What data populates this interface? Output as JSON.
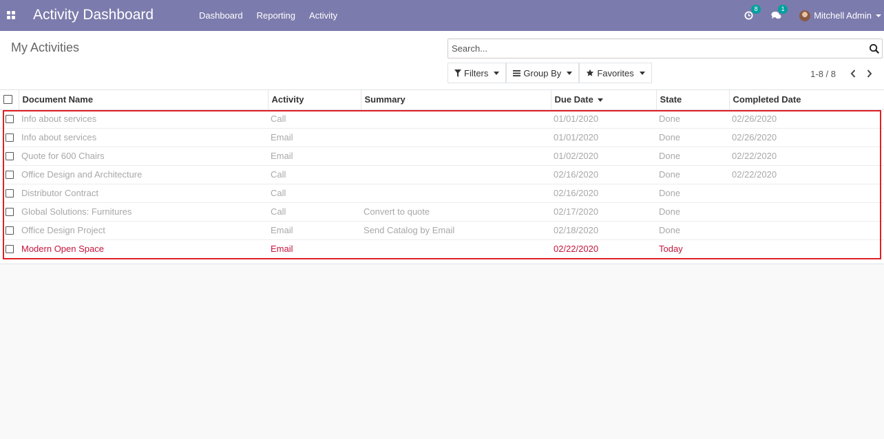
{
  "navbar": {
    "brand": "Activity Dashboard",
    "menu": [
      "Dashboard",
      "Reporting",
      "Activity"
    ],
    "activity_count": "8",
    "message_count": "1",
    "user_name": "Mitchell Admin",
    "color": "#7c7bad"
  },
  "control_panel": {
    "title": "My Activities",
    "search_placeholder": "Search...",
    "filters_label": "Filters",
    "group_by_label": "Group By",
    "favorites_label": "Favorites",
    "pager": "1-8 / 8"
  },
  "list": {
    "columns": [
      "Document Name",
      "Activity",
      "Summary",
      "Due Date",
      "State",
      "Completed Date"
    ],
    "rows": [
      {
        "document": "Info about services",
        "activity": "Call",
        "summary": "",
        "due": "01/01/2020",
        "state": "Done",
        "completed": "02/26/2020",
        "status": "done"
      },
      {
        "document": "Info about services",
        "activity": "Email",
        "summary": "",
        "due": "01/01/2020",
        "state": "Done",
        "completed": "02/26/2020",
        "status": "done"
      },
      {
        "document": "Quote for 600 Chairs",
        "activity": "Email",
        "summary": "",
        "due": "01/02/2020",
        "state": "Done",
        "completed": "02/22/2020",
        "status": "done"
      },
      {
        "document": "Office Design and Architecture",
        "activity": "Call",
        "summary": "",
        "due": "02/16/2020",
        "state": "Done",
        "completed": "02/22/2020",
        "status": "done"
      },
      {
        "document": "Distributor Contract",
        "activity": "Call",
        "summary": "",
        "due": "02/16/2020",
        "state": "Done",
        "completed": "",
        "status": "done"
      },
      {
        "document": "Global Solutions: Furnitures",
        "activity": "Call",
        "summary": "Convert to quote",
        "due": "02/17/2020",
        "state": "Done",
        "completed": "",
        "status": "done"
      },
      {
        "document": "Office Design Project",
        "activity": "Email",
        "summary": "Send Catalog by Email",
        "due": "02/18/2020",
        "state": "Done",
        "completed": "",
        "status": "done"
      },
      {
        "document": "Modern Open Space",
        "activity": "Email",
        "summary": "",
        "due": "02/22/2020",
        "state": "Today",
        "completed": "",
        "status": "today"
      }
    ],
    "colors": {
      "done": "#a8a8a8",
      "today": "#c4143c",
      "highlight": "#e01f26"
    }
  }
}
